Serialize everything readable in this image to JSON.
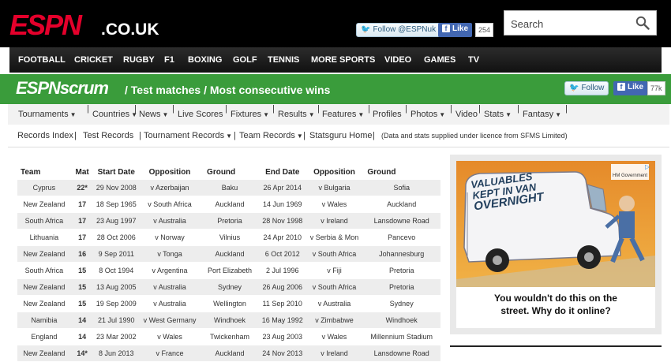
{
  "header": {
    "logo_text": "ESPN",
    "logo_suffix": ".CO.UK",
    "twitter_label": "Follow @ESPNuk",
    "facebook_label": "Like",
    "facebook_count": "254",
    "search_placeholder": "Search"
  },
  "sport_nav": [
    "FOOTBALL",
    "CRICKET",
    "RUGBY",
    "F1",
    "BOXING",
    "GOLF",
    "TENNIS",
    "MORE SPORTS",
    "VIDEO",
    "GAMES",
    "TV"
  ],
  "scrum": {
    "logo_text": "ESPNscrum",
    "title": "/ Test matches  / Most consecutive wins",
    "twitter_label": "Follow",
    "facebook_label": "Like",
    "facebook_count": "77k"
  },
  "menu1": [
    "Tournaments",
    "Countries",
    "News",
    "Live Scores",
    "Fixtures",
    "Results",
    "Features",
    "Profiles",
    "Photos",
    "Video",
    "Stats",
    "Fantasy"
  ],
  "menu2": {
    "items": [
      "Records Index",
      "Test Records",
      "Tournament Records",
      "Team Records",
      "Statsguru Home"
    ],
    "note": "(Data and stats supplied under licence from SFMS Limited)"
  },
  "table": {
    "headers": [
      "Team",
      "Mat",
      "Start Date",
      "Opposition",
      "Ground",
      "End Date",
      "Opposition",
      "Ground"
    ],
    "rows": [
      [
        "Cyprus",
        "22*",
        "29 Nov 2008",
        "v Azerbaijan",
        "Baku",
        "26 Apr 2014",
        "v Bulgaria",
        "Sofia"
      ],
      [
        "New Zealand",
        "17",
        "18 Sep 1965",
        "v South Africa",
        "Auckland",
        "14 Jun 1969",
        "v Wales",
        "Auckland"
      ],
      [
        "South Africa",
        "17",
        "23 Aug 1997",
        "v Australia",
        "Pretoria",
        "28 Nov 1998",
        "v Ireland",
        "Lansdowne Road"
      ],
      [
        "Lithuania",
        "17",
        "28 Oct 2006",
        "v Norway",
        "Vilnius",
        "24 Apr 2010",
        "v Serbia & Mon",
        "Pancevo"
      ],
      [
        "New Zealand",
        "16",
        "9 Sep 2011",
        "v Tonga",
        "Auckland",
        "6 Oct 2012",
        "v South Africa",
        "Johannesburg"
      ],
      [
        "South Africa",
        "15",
        "8 Oct 1994",
        "v Argentina",
        "Port Elizabeth",
        "2 Jul 1996",
        "v Fiji",
        "Pretoria"
      ],
      [
        "New Zealand",
        "15",
        "13 Aug 2005",
        "v Australia",
        "Sydney",
        "26 Aug 2006",
        "v South Africa",
        "Pretoria"
      ],
      [
        "New Zealand",
        "15",
        "19 Sep 2009",
        "v Australia",
        "Wellington",
        "11 Sep 2010",
        "v Australia",
        "Sydney"
      ],
      [
        "Namibia",
        "14",
        "21 Jul 1990",
        "v West Germany",
        "Windhoek",
        "16 May 1992",
        "v Zimbabwe",
        "Windhoek"
      ],
      [
        "England",
        "14",
        "23 Mar 2002",
        "v Wales",
        "Twickenham",
        "23 Aug 2003",
        "v Wales",
        "Millennium Stadium"
      ],
      [
        "New Zealand",
        "14*",
        "8 Jun 2013",
        "v France",
        "Auckland",
        "24 Nov 2013",
        "v Ireland",
        "Lansdowne Road"
      ]
    ]
  },
  "ad": {
    "van_text_1": "VALUABLES",
    "van_text_2": "KEPT IN VAN",
    "van_text_3": "OVERNIGHT",
    "sponsor": "HM Government",
    "caption_1": "You wouldn't do this on the",
    "caption_2": "street. Why do it online?"
  },
  "colors": {
    "espn_red": "#e4002b",
    "scrum_green": "#3a9c3b",
    "header_black": "#000000"
  }
}
